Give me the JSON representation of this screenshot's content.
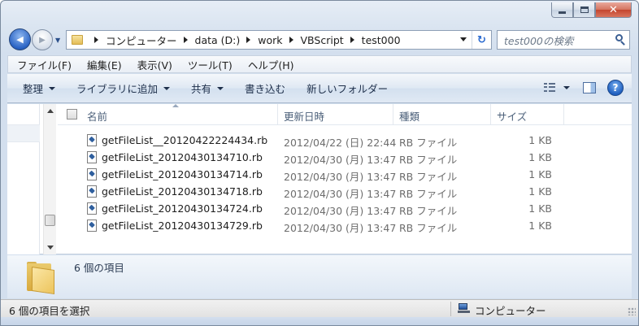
{
  "window": {
    "caption": {
      "minimize": "—",
      "maximize": "□",
      "close": "✕"
    }
  },
  "nav": {
    "back_glyph": "◀",
    "forward_glyph": "▶",
    "dropdown_glyph": "▼",
    "breadcrumbs": [
      "コンピューター",
      "data (D:)",
      "work",
      "VBScript",
      "test000"
    ],
    "refresh_glyph": "↻",
    "search_placeholder": "test000の検索"
  },
  "menu": [
    "ファイル(F)",
    "編集(E)",
    "表示(V)",
    "ツール(T)",
    "ヘルプ(H)"
  ],
  "toolbar": {
    "organize": "整理",
    "add_to_library": "ライブラリに追加",
    "share": "共有",
    "burn": "書き込む",
    "new_folder": "新しいフォルダー",
    "help": "?"
  },
  "columns": {
    "name": "名前",
    "date": "更新日時",
    "type": "種類",
    "size": "サイズ"
  },
  "files": [
    {
      "name": "getFileList__20120422224434.rb",
      "date": "2012/04/22 (日) 22:44",
      "type": "RB ファイル",
      "size": "1 KB"
    },
    {
      "name": "getFileList_20120430134710.rb",
      "date": "2012/04/30 (月) 13:47",
      "type": "RB ファイル",
      "size": "1 KB"
    },
    {
      "name": "getFileList_20120430134714.rb",
      "date": "2012/04/30 (月) 13:47",
      "type": "RB ファイル",
      "size": "1 KB"
    },
    {
      "name": "getFileList_20120430134718.rb",
      "date": "2012/04/30 (月) 13:47",
      "type": "RB ファイル",
      "size": "1 KB"
    },
    {
      "name": "getFileList_20120430134724.rb",
      "date": "2012/04/30 (月) 13:47",
      "type": "RB ファイル",
      "size": "1 KB"
    },
    {
      "name": "getFileList_20120430134729.rb",
      "date": "2012/04/30 (月) 13:47",
      "type": "RB ファイル",
      "size": "1 KB"
    }
  ],
  "details": {
    "item_count": "6 個の項目"
  },
  "status": {
    "selection": "6 個の項目を選択",
    "location": "コンピューター"
  }
}
